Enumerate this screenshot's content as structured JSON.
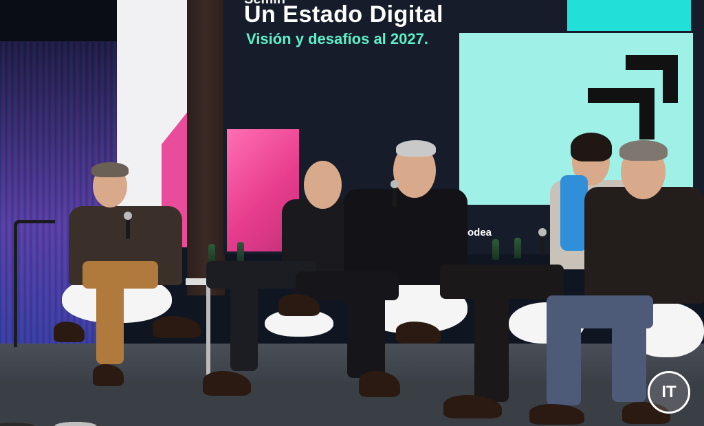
{
  "screen": {
    "title_partial": "Semin",
    "title": "Un Estado Digital",
    "subtitle": "Visión y desafíos al 2027.",
    "logo": "odea"
  },
  "watermark": {
    "text": "IT"
  },
  "colors": {
    "screen_accent": "#5ff0c8",
    "cyan_panel": "#9ff0e6",
    "pink_panel": "#e94c9a"
  }
}
